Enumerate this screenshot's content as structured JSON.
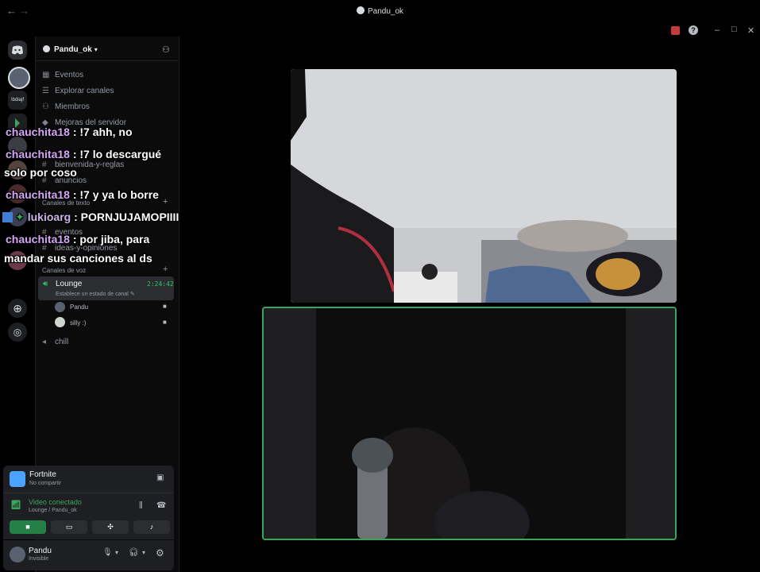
{
  "window": {
    "title": "Pandu_ok",
    "back_arrow": "←",
    "forward_arrow": "→",
    "controls": {
      "minimize": "–",
      "maximize": "□",
      "close": "✕",
      "help": "?"
    }
  },
  "server_rail": {
    "items": [
      "discord-home",
      "server-avatar",
      "Ibdiajf",
      "server-green",
      "server-3",
      "server-4",
      "server-5",
      "server-6",
      "server-7",
      "add-server",
      "discover"
    ],
    "label_small": "Ibdiajf"
  },
  "server": {
    "name": "Pandu_ok",
    "menu": [
      {
        "icon": "calendar-icon",
        "label": "Eventos"
      },
      {
        "icon": "browse-channels-icon",
        "label": "Explorar canales"
      },
      {
        "icon": "members-icon",
        "label": "Miembros"
      },
      {
        "icon": "boost-icon",
        "label": "Mejoras del servidor"
      }
    ],
    "info_channels": [
      "bienvenida-y-reglas",
      "anuncios"
    ],
    "text_category": "Canales de texto",
    "text_channels": [
      "eventos",
      "ideas-y-opiniones"
    ],
    "voice_category": "Canales de voz",
    "voice_channels": [
      {
        "name": "Lounge",
        "time": "2:24:42",
        "status_placeholder": "Establece un estado de canal",
        "users": [
          "Pandu",
          "silly :)"
        ]
      },
      {
        "name": "chill"
      }
    ]
  },
  "chat_overlay": [
    {
      "user": "chauchita18",
      "text": " : !7 ahh, no"
    },
    {
      "user": "chauchita18",
      "text": " : !7 lo descargué"
    },
    {
      "user": "",
      "text": "solo por coso"
    },
    {
      "user": "chauchita18",
      "text": " : !7 y ya lo borre"
    },
    {
      "user": "lukioarg",
      "text": " : PORNJUJAMOPIIII"
    },
    {
      "user": "chauchita18",
      "text": " : por jiba, para"
    },
    {
      "user": "",
      "text": "mandar sus canciones al ds"
    }
  ],
  "activity": {
    "game": "Fortnite",
    "sub": "No compartir"
  },
  "voice_connection": {
    "status": "Video conectado",
    "location": "Lounge / Pandu_ok",
    "buttons": [
      "camera-button",
      "screen-share-button",
      "activities-button",
      "soundboard-button"
    ]
  },
  "user": {
    "name": "Pandu",
    "status": "Invisible"
  },
  "colors": {
    "accent_green": "#3ba55c",
    "chat_username": "#d4a6f5",
    "sidebar_bg": "#0b0b0c"
  }
}
